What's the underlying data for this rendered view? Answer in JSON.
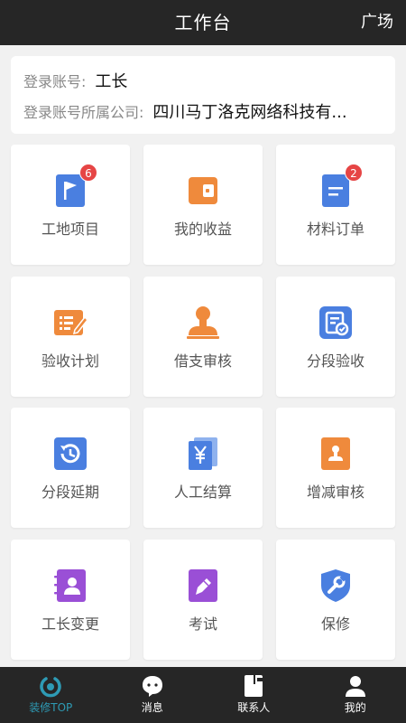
{
  "header": {
    "title": "工作台",
    "right_label": "广场"
  },
  "account": {
    "login_label": "登录账号:",
    "login_value": "工长",
    "company_label": "登录账号所属公司:",
    "company_value": "四川马丁洛克网络科技有..."
  },
  "tiles": [
    {
      "label": "工地项目",
      "icon": "flag-icon",
      "badge": "6"
    },
    {
      "label": "我的收益",
      "icon": "wallet-icon",
      "badge": ""
    },
    {
      "label": "材料订单",
      "icon": "order-icon",
      "badge": "2"
    },
    {
      "label": "验收计划",
      "icon": "plan-icon",
      "badge": ""
    },
    {
      "label": "借支审核",
      "icon": "stamp-icon",
      "badge": ""
    },
    {
      "label": "分段验收",
      "icon": "check-doc-icon",
      "badge": ""
    },
    {
      "label": "分段延期",
      "icon": "history-icon",
      "badge": ""
    },
    {
      "label": "人工结算",
      "icon": "yen-doc-icon",
      "badge": ""
    },
    {
      "label": "增减审核",
      "icon": "review-icon",
      "badge": ""
    },
    {
      "label": "工长变更",
      "icon": "contact-book-icon",
      "badge": ""
    },
    {
      "label": "考试",
      "icon": "exam-icon",
      "badge": ""
    },
    {
      "label": "保修",
      "icon": "wrench-shield-icon",
      "badge": ""
    }
  ],
  "nav": [
    {
      "label": "装修TOP",
      "icon": "home-ring-icon"
    },
    {
      "label": "消息",
      "icon": "chat-icon"
    },
    {
      "label": "联系人",
      "icon": "contacts-icon"
    },
    {
      "label": "我的",
      "icon": "user-icon"
    }
  ],
  "colors": {
    "header_bg": "#262626",
    "accent": "#2e9bb5",
    "blue": "#4a7fe0",
    "orange": "#ef8a3c",
    "purple": "#9a4fd6",
    "badge": "#e64545"
  }
}
